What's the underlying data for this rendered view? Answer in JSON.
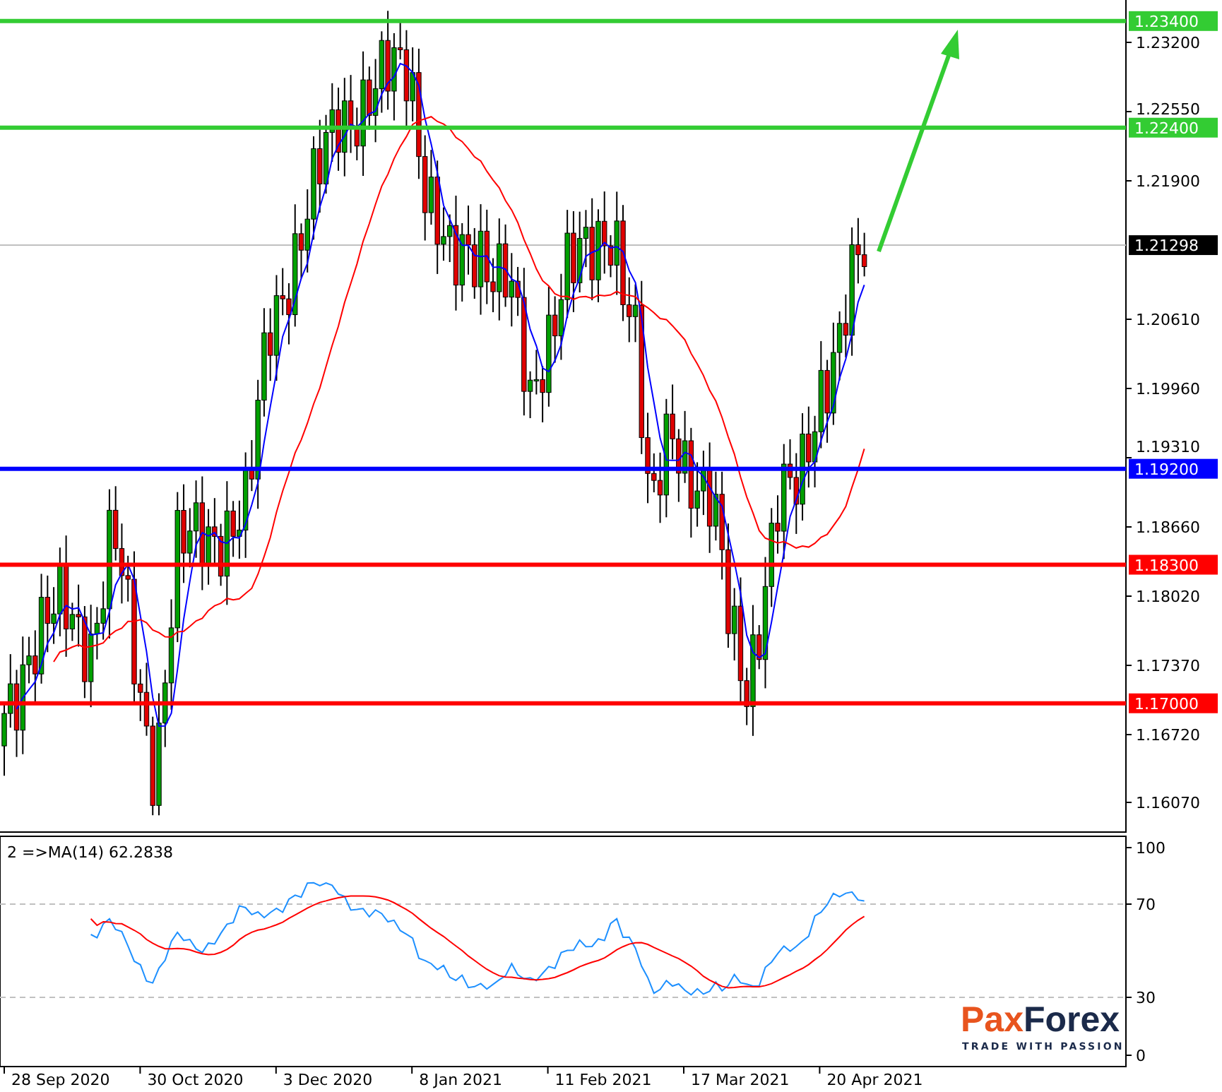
{
  "price_axis": {
    "ticks": [
      "1.23200",
      "1.22550",
      "1.21900",
      "1.20610",
      "1.19960",
      "1.19310",
      "1.18660",
      "1.18020",
      "1.17370",
      "1.16720",
      "1.16070"
    ]
  },
  "levels": [
    {
      "price": "1.23400",
      "color": "#33cc33"
    },
    {
      "price": "1.22400",
      "color": "#33cc33"
    },
    {
      "price": "1.19200",
      "color": "#0000ff"
    },
    {
      "price": "1.18300",
      "color": "#ff0000"
    },
    {
      "price": "1.17000",
      "color": "#ff0000"
    }
  ],
  "current_price": "1.21298",
  "indicator": {
    "label": "2  =>MA(14) 62.2838",
    "ticks": [
      "100",
      "70",
      "30",
      "0"
    ]
  },
  "time_axis": [
    "28 Sep 2020",
    "30 Oct 2020",
    "3 Dec 2020",
    "8 Jan 2021",
    "11 Feb 2021",
    "17 Mar 2021",
    "20 Apr 2021"
  ],
  "logo": {
    "lead": "Pax",
    "rest": "Forex",
    "tagline": "TRADE WITH PASSION"
  }
}
